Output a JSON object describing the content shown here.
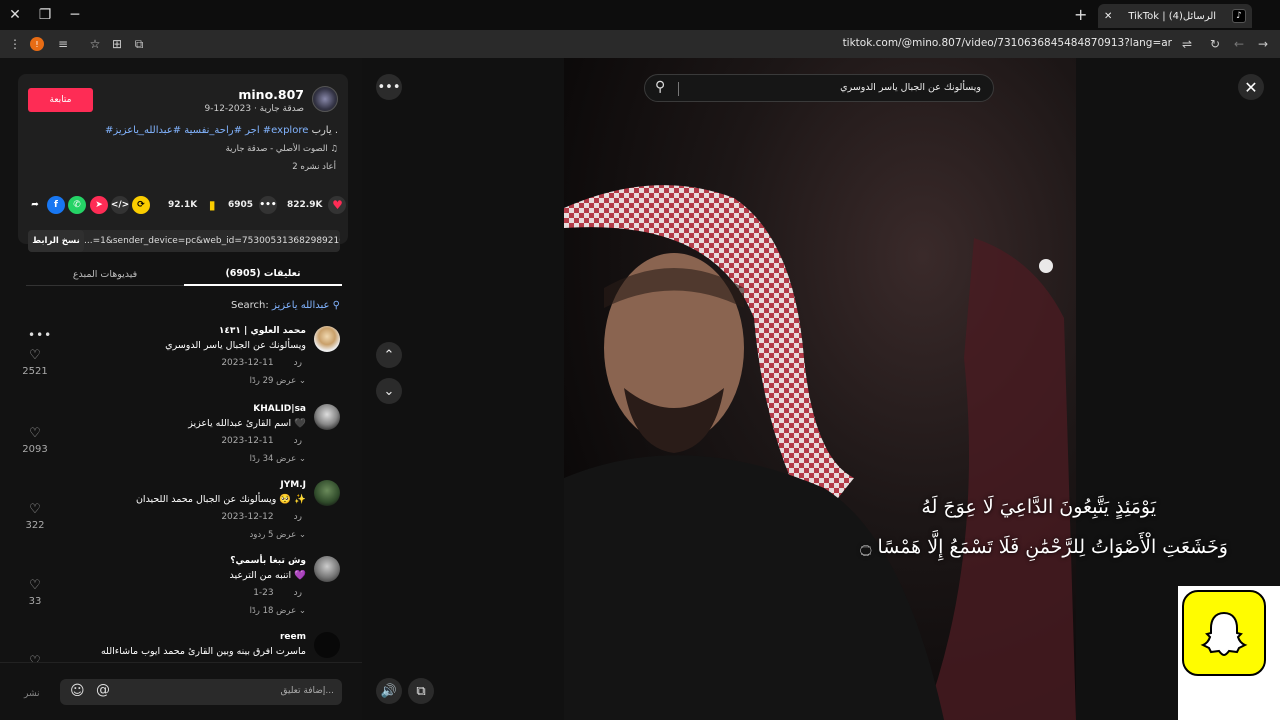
{
  "browser": {
    "tab_title": "TikTok | الرسائل(4)",
    "url": "tiktok.com/@mino.807/video/7310636845484870913?lang=ar"
  },
  "post": {
    "follow_label": "متابعة",
    "username": "mino.807",
    "subline": "صدقة جارية · 2023-12-9",
    "desc_prefix": "يارب .",
    "desc_tags": "#اجر #راحة_نفسية #عبدالله_ياعزيز #explore",
    "music": "الصوت الأصلي - صدقة جارية",
    "reposts": "2 أعاد نشره"
  },
  "actions": {
    "likes": "822.9K",
    "comments": "6905",
    "saves": "92.1K"
  },
  "link": {
    "copy_label": "نسخ الرابط",
    "text": "...=1&sender_device=pc&web_id=7530053136829892103"
  },
  "tabs": {
    "comments": "تعليقات (6905)",
    "creator_videos": "فيديوهات المبدع"
  },
  "search_hint": {
    "label": "Search:",
    "query": "عبدالله ياعزيز"
  },
  "comments": [
    {
      "name": "محمد العلوي | ١٤٣١",
      "text": "ويسألونك عن الجبال ياسر الدوسري",
      "date": "2023-12-11",
      "reply": "رد",
      "replies": "عرض 29 ردًا",
      "likes": "2521"
    },
    {
      "name": "KHALID|sa",
      "text": "اسم القارئ عبدالله ياعزيز 🖤",
      "date": "2023-12-11",
      "reply": "رد",
      "replies": "عرض 34 ردًا",
      "likes": "2093"
    },
    {
      "name": "JYM.J",
      "text": "ويسألونك عن الجبال محمد اللحيدان 🥺 ✨",
      "date": "2023-12-12",
      "reply": "رد",
      "replies": "عرض 5 ردود",
      "likes": "322"
    },
    {
      "name": "وش تبغا بأسمي؟",
      "text": "اتنبه من الترعيد 💜",
      "date": "1-23",
      "reply": "رد",
      "replies": "عرض 18 ردًا",
      "likes": "33"
    },
    {
      "name": "reem",
      "text": "ماسرت افرق بينه وبين القارئ محمد ايوب ماشاءالله",
      "date": "",
      "reply": "",
      "replies": "",
      "likes": ""
    }
  ],
  "composer": {
    "placeholder": "إضافة تعليق...",
    "post_label": "نشر"
  },
  "video": {
    "search_text": "ويسألونك عن الجبال ياسر الدوسري",
    "verse_line1": "يَوْمَئِذٍ يَتَّبِعُونَ الدَّاعِيَ لَا عِوَجَ لَهُ",
    "verse_line2": "وَخَشَعَتِ الْأَصْوَاتُ لِلرَّحْمَٰنِ فَلَا تَسْمَعُ إِلَّا هَمْسًا ۝"
  },
  "colors": {
    "accent": "#fe2c55",
    "tag": "#82b4ff",
    "snap": "#fffc00"
  }
}
